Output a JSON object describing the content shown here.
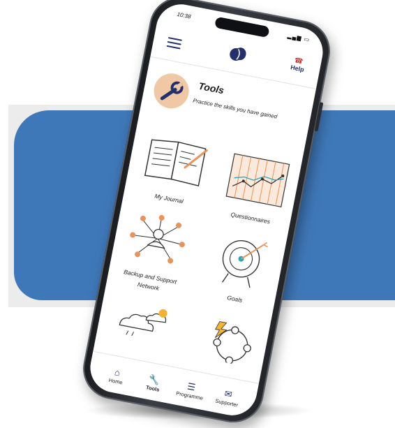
{
  "status_bar": {
    "time": "10:38",
    "system": "▂▄▆ ▭"
  },
  "header": {
    "help_label": "Help"
  },
  "section": {
    "title": "Tools",
    "subtitle": "Practice the skills you have gained"
  },
  "tiles": [
    {
      "label": "My Journal"
    },
    {
      "label": "Questionnaires"
    },
    {
      "label": "Backup and Support Network"
    },
    {
      "label": "Goals"
    }
  ],
  "tabs": [
    {
      "label": "Home",
      "icon": "home-icon"
    },
    {
      "label": "Tools",
      "icon": "wrench-icon"
    },
    {
      "label": "Programme",
      "icon": "checklist-icon"
    },
    {
      "label": "Supporter",
      "icon": "envelope-icon"
    }
  ],
  "colors": {
    "brand_navy": "#24306b",
    "accent_teal": "#2aa6b8",
    "accent_orange": "#e8935a",
    "banner_blue": "#3f78b9",
    "help_red": "#d0312d"
  }
}
